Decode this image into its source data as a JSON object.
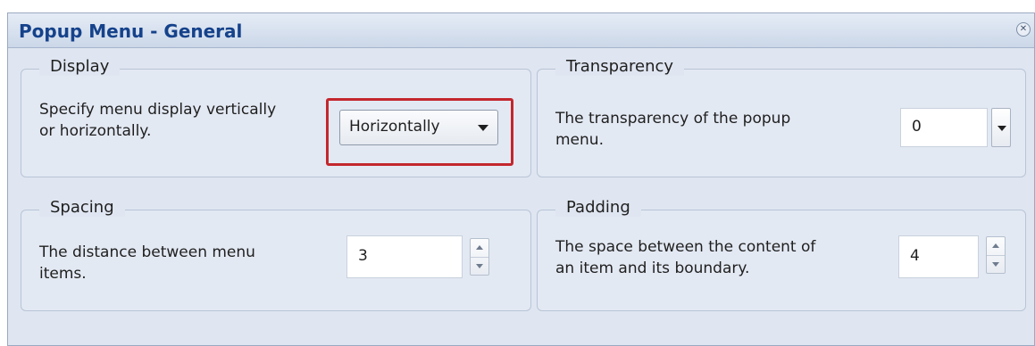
{
  "window": {
    "title": "Popup Menu - General",
    "close_icon": "close-icon"
  },
  "display": {
    "label": "Display",
    "description_line1": "Specify menu display vertically",
    "description_line2": "or horizontally.",
    "selected_value": "Horizontally",
    "highlight_color": "#c3272d"
  },
  "transparency": {
    "label": "Transparency",
    "description_line1": "The transparency of the popup",
    "description_line2": "menu.",
    "value": "0"
  },
  "spacing": {
    "label": "Spacing",
    "description_line1": "The distance between menu",
    "description_line2": "items.",
    "value": "3"
  },
  "padding": {
    "label": "Padding",
    "description_line1": "The space between the content of",
    "description_line2": "an item and its boundary.",
    "value": "4"
  },
  "colors": {
    "title_text": "#15428b",
    "panel_background": "#dfe6f1"
  }
}
